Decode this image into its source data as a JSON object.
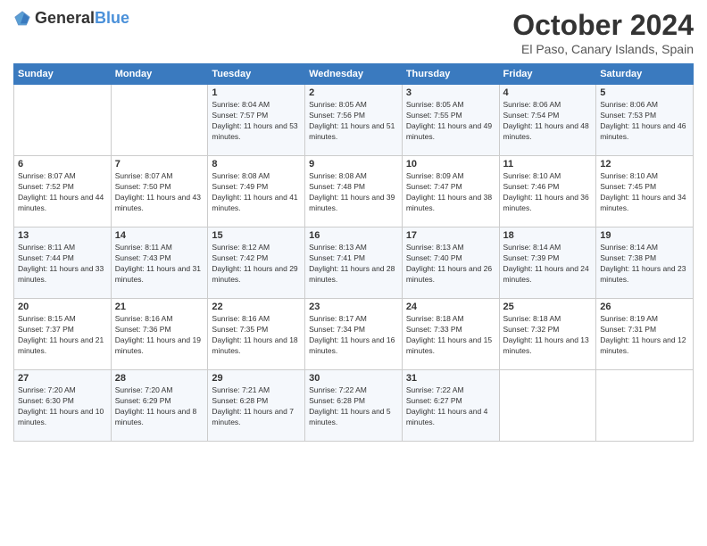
{
  "header": {
    "logo_general": "General",
    "logo_blue": "Blue",
    "title": "October 2024",
    "location": "El Paso, Canary Islands, Spain"
  },
  "weekdays": [
    "Sunday",
    "Monday",
    "Tuesday",
    "Wednesday",
    "Thursday",
    "Friday",
    "Saturday"
  ],
  "weeks": [
    [
      {
        "day": "",
        "sunrise": "",
        "sunset": "",
        "daylight": ""
      },
      {
        "day": "",
        "sunrise": "",
        "sunset": "",
        "daylight": ""
      },
      {
        "day": "1",
        "sunrise": "Sunrise: 8:04 AM",
        "sunset": "Sunset: 7:57 PM",
        "daylight": "Daylight: 11 hours and 53 minutes."
      },
      {
        "day": "2",
        "sunrise": "Sunrise: 8:05 AM",
        "sunset": "Sunset: 7:56 PM",
        "daylight": "Daylight: 11 hours and 51 minutes."
      },
      {
        "day": "3",
        "sunrise": "Sunrise: 8:05 AM",
        "sunset": "Sunset: 7:55 PM",
        "daylight": "Daylight: 11 hours and 49 minutes."
      },
      {
        "day": "4",
        "sunrise": "Sunrise: 8:06 AM",
        "sunset": "Sunset: 7:54 PM",
        "daylight": "Daylight: 11 hours and 48 minutes."
      },
      {
        "day": "5",
        "sunrise": "Sunrise: 8:06 AM",
        "sunset": "Sunset: 7:53 PM",
        "daylight": "Daylight: 11 hours and 46 minutes."
      }
    ],
    [
      {
        "day": "6",
        "sunrise": "Sunrise: 8:07 AM",
        "sunset": "Sunset: 7:52 PM",
        "daylight": "Daylight: 11 hours and 44 minutes."
      },
      {
        "day": "7",
        "sunrise": "Sunrise: 8:07 AM",
        "sunset": "Sunset: 7:50 PM",
        "daylight": "Daylight: 11 hours and 43 minutes."
      },
      {
        "day": "8",
        "sunrise": "Sunrise: 8:08 AM",
        "sunset": "Sunset: 7:49 PM",
        "daylight": "Daylight: 11 hours and 41 minutes."
      },
      {
        "day": "9",
        "sunrise": "Sunrise: 8:08 AM",
        "sunset": "Sunset: 7:48 PM",
        "daylight": "Daylight: 11 hours and 39 minutes."
      },
      {
        "day": "10",
        "sunrise": "Sunrise: 8:09 AM",
        "sunset": "Sunset: 7:47 PM",
        "daylight": "Daylight: 11 hours and 38 minutes."
      },
      {
        "day": "11",
        "sunrise": "Sunrise: 8:10 AM",
        "sunset": "Sunset: 7:46 PM",
        "daylight": "Daylight: 11 hours and 36 minutes."
      },
      {
        "day": "12",
        "sunrise": "Sunrise: 8:10 AM",
        "sunset": "Sunset: 7:45 PM",
        "daylight": "Daylight: 11 hours and 34 minutes."
      }
    ],
    [
      {
        "day": "13",
        "sunrise": "Sunrise: 8:11 AM",
        "sunset": "Sunset: 7:44 PM",
        "daylight": "Daylight: 11 hours and 33 minutes."
      },
      {
        "day": "14",
        "sunrise": "Sunrise: 8:11 AM",
        "sunset": "Sunset: 7:43 PM",
        "daylight": "Daylight: 11 hours and 31 minutes."
      },
      {
        "day": "15",
        "sunrise": "Sunrise: 8:12 AM",
        "sunset": "Sunset: 7:42 PM",
        "daylight": "Daylight: 11 hours and 29 minutes."
      },
      {
        "day": "16",
        "sunrise": "Sunrise: 8:13 AM",
        "sunset": "Sunset: 7:41 PM",
        "daylight": "Daylight: 11 hours and 28 minutes."
      },
      {
        "day": "17",
        "sunrise": "Sunrise: 8:13 AM",
        "sunset": "Sunset: 7:40 PM",
        "daylight": "Daylight: 11 hours and 26 minutes."
      },
      {
        "day": "18",
        "sunrise": "Sunrise: 8:14 AM",
        "sunset": "Sunset: 7:39 PM",
        "daylight": "Daylight: 11 hours and 24 minutes."
      },
      {
        "day": "19",
        "sunrise": "Sunrise: 8:14 AM",
        "sunset": "Sunset: 7:38 PM",
        "daylight": "Daylight: 11 hours and 23 minutes."
      }
    ],
    [
      {
        "day": "20",
        "sunrise": "Sunrise: 8:15 AM",
        "sunset": "Sunset: 7:37 PM",
        "daylight": "Daylight: 11 hours and 21 minutes."
      },
      {
        "day": "21",
        "sunrise": "Sunrise: 8:16 AM",
        "sunset": "Sunset: 7:36 PM",
        "daylight": "Daylight: 11 hours and 19 minutes."
      },
      {
        "day": "22",
        "sunrise": "Sunrise: 8:16 AM",
        "sunset": "Sunset: 7:35 PM",
        "daylight": "Daylight: 11 hours and 18 minutes."
      },
      {
        "day": "23",
        "sunrise": "Sunrise: 8:17 AM",
        "sunset": "Sunset: 7:34 PM",
        "daylight": "Daylight: 11 hours and 16 minutes."
      },
      {
        "day": "24",
        "sunrise": "Sunrise: 8:18 AM",
        "sunset": "Sunset: 7:33 PM",
        "daylight": "Daylight: 11 hours and 15 minutes."
      },
      {
        "day": "25",
        "sunrise": "Sunrise: 8:18 AM",
        "sunset": "Sunset: 7:32 PM",
        "daylight": "Daylight: 11 hours and 13 minutes."
      },
      {
        "day": "26",
        "sunrise": "Sunrise: 8:19 AM",
        "sunset": "Sunset: 7:31 PM",
        "daylight": "Daylight: 11 hours and 12 minutes."
      }
    ],
    [
      {
        "day": "27",
        "sunrise": "Sunrise: 7:20 AM",
        "sunset": "Sunset: 6:30 PM",
        "daylight": "Daylight: 11 hours and 10 minutes."
      },
      {
        "day": "28",
        "sunrise": "Sunrise: 7:20 AM",
        "sunset": "Sunset: 6:29 PM",
        "daylight": "Daylight: 11 hours and 8 minutes."
      },
      {
        "day": "29",
        "sunrise": "Sunrise: 7:21 AM",
        "sunset": "Sunset: 6:28 PM",
        "daylight": "Daylight: 11 hours and 7 minutes."
      },
      {
        "day": "30",
        "sunrise": "Sunrise: 7:22 AM",
        "sunset": "Sunset: 6:28 PM",
        "daylight": "Daylight: 11 hours and 5 minutes."
      },
      {
        "day": "31",
        "sunrise": "Sunrise: 7:22 AM",
        "sunset": "Sunset: 6:27 PM",
        "daylight": "Daylight: 11 hours and 4 minutes."
      },
      {
        "day": "",
        "sunrise": "",
        "sunset": "",
        "daylight": ""
      },
      {
        "day": "",
        "sunrise": "",
        "sunset": "",
        "daylight": ""
      }
    ]
  ]
}
